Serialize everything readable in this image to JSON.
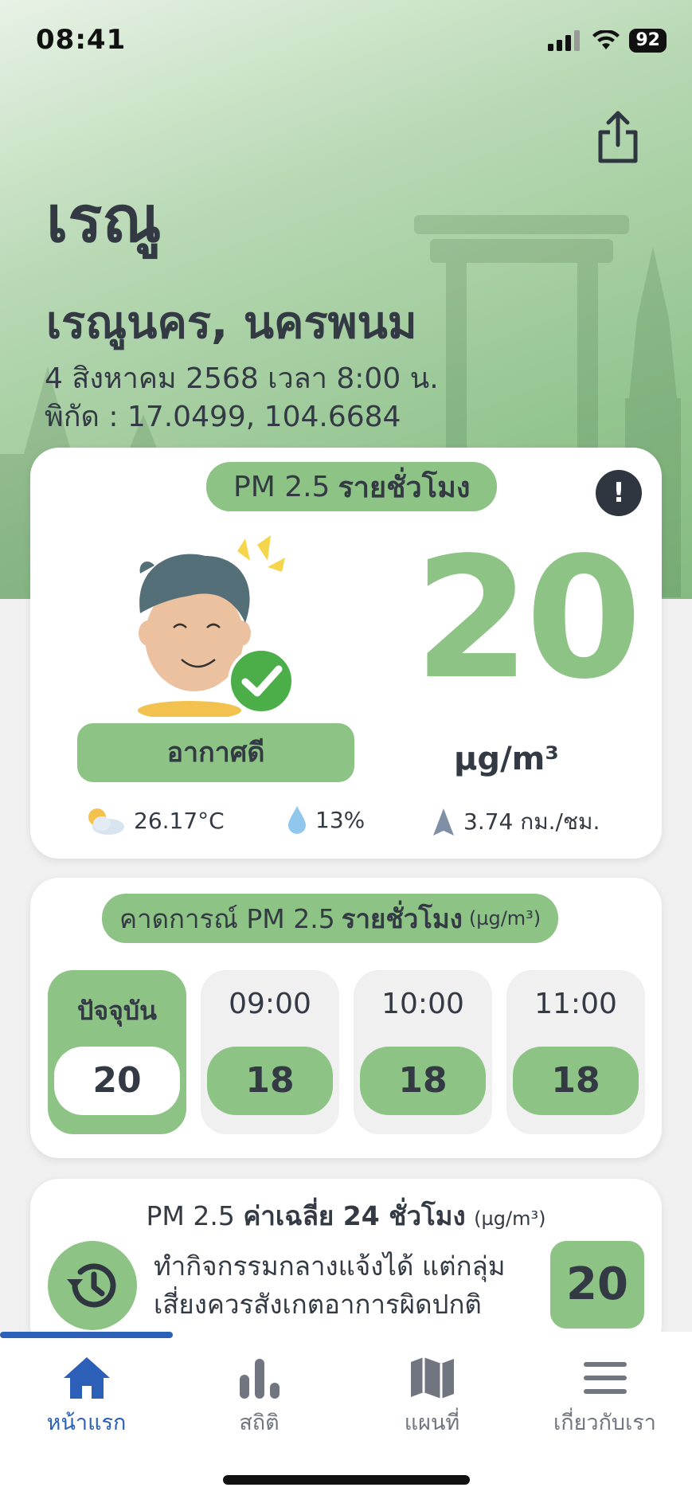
{
  "status_bar": {
    "time": "08:41",
    "battery": "92"
  },
  "station": {
    "short_name": "เรณู",
    "full_name": "เรณูนคร, นครพนม",
    "date_time": "4 สิงหาคม 2568  เวลา 8:00 น.",
    "coordinates": "พิกัด : 17.0499, 104.6684"
  },
  "main_card": {
    "pill_prefix": "PM 2.5",
    "pill_bold": "รายชั่วโมง",
    "info_icon": "!",
    "aqi_value": "20",
    "unit": "µg/m³",
    "quality_label": "อากาศดี",
    "quality_color": "#8dc385",
    "weather": {
      "temperature": "26.17°C",
      "humidity": "13%",
      "wind": "3.74 กม./ชม."
    }
  },
  "forecast": {
    "title_prefix": "คาดการณ์ PM 2.5",
    "title_bold": "รายชั่วโมง",
    "title_unit": "(µg/m³)",
    "slots": [
      {
        "time": "ปัจจุบัน",
        "value": "20"
      },
      {
        "time": "09:00",
        "value": "18"
      },
      {
        "time": "10:00",
        "value": "18"
      },
      {
        "time": "11:00",
        "value": "18"
      }
    ]
  },
  "average": {
    "title_prefix": "PM 2.5",
    "title_bold": "ค่าเฉลี่ย 24 ชั่วโมง",
    "title_unit": "(µg/m³)",
    "advice_line1": "ทำกิจกรรมกลางแจ้งได้ แต่กลุ่ม",
    "advice_line2": "เสี่ยงควรสังเกตอาการผิดปกติ",
    "value": "20"
  },
  "tabs": [
    {
      "label": "หน้าแรก",
      "icon": "home-icon"
    },
    {
      "label": "สถิติ",
      "icon": "bar-chart-icon"
    },
    {
      "label": "แผนที่",
      "icon": "map-icon"
    },
    {
      "label": "เกี่ยวกับเรา",
      "icon": "menu-icon"
    }
  ],
  "colors": {
    "accent_green": "#8dc385",
    "active_blue": "#2c5fb8",
    "text_dark": "#333a44"
  }
}
